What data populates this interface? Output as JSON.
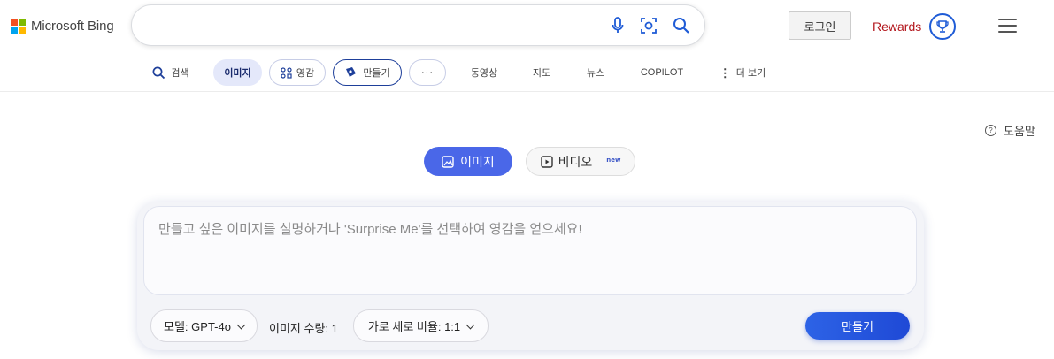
{
  "header": {
    "logo_text": "Microsoft Bing",
    "logo_colors": [
      "#f25022",
      "#7fba00",
      "#00a4ef",
      "#ffb900"
    ],
    "search": {
      "value": "",
      "icons": [
        "microphone-icon",
        "visual-search-icon",
        "search-icon"
      ]
    },
    "login_label": "로그인",
    "rewards_label": "Rewards",
    "accent": "#1e5bd6"
  },
  "nav": {
    "search": "검색",
    "images": "이미지",
    "inspiration": "영감",
    "create": "만들기",
    "more_dots": "···",
    "videos": "동영상",
    "maps": "지도",
    "news": "뉴스",
    "copilot": "COPILOT",
    "more": "더 보기"
  },
  "help_label": "도움말",
  "modes": {
    "image": "이미지",
    "video": "비디오",
    "video_badge": "new"
  },
  "prompt": {
    "placeholder": "만들고 싶은 이미지를 설명하거나 'Surprise Me'를 선택하여 영감을 얻으세요!"
  },
  "options": {
    "model": "모델: GPT-4o",
    "image_count": "이미지 수량: 1",
    "aspect_ratio": "가로 세로 비율: 1:1",
    "create_button": "만들기"
  }
}
